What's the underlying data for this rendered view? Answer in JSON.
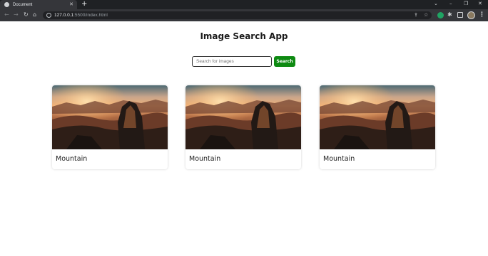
{
  "browser": {
    "tab_title": "Document",
    "url_host": "127.0.0.1",
    "url_path": ":5500/index.html"
  },
  "page": {
    "title": "Image Search App",
    "search": {
      "placeholder": "Search for images",
      "value": ""
    },
    "search_button_label": "Search",
    "cards": [
      {
        "caption": "Mountain"
      },
      {
        "caption": "Mountain"
      },
      {
        "caption": "Mountain"
      }
    ]
  },
  "colors": {
    "accent_button": "#0e8a12",
    "chrome_dark": "#35363a"
  }
}
